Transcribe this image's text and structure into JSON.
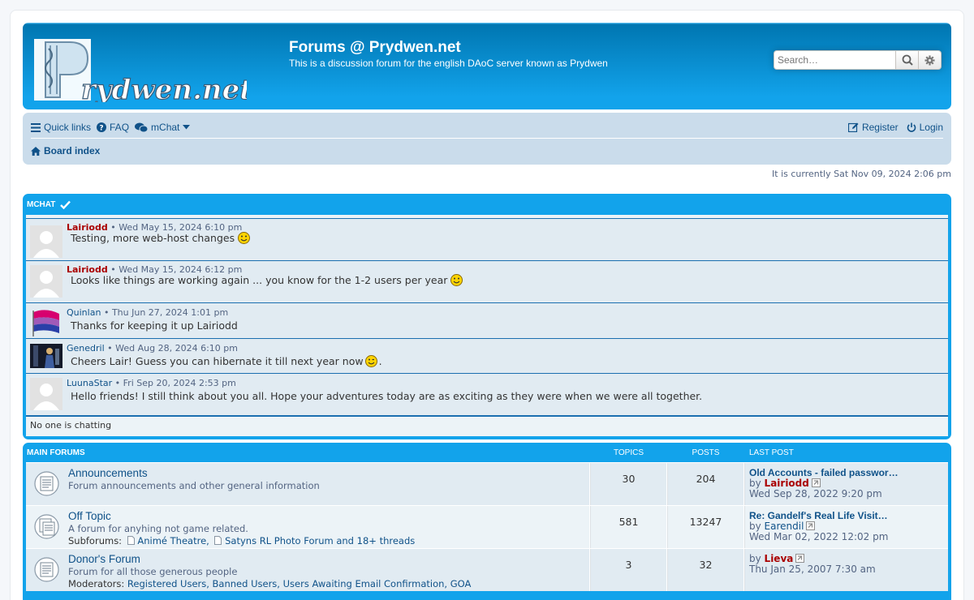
{
  "header": {
    "site_title": "Forums @ Prydwen.net",
    "site_description": "This is a discussion forum for the english DAoC server known as Prydwen",
    "logo_text": "Prydwen.net",
    "search_placeholder": "Search…"
  },
  "nav": {
    "quick_links": "Quick links",
    "faq": "FAQ",
    "mchat": "mChat",
    "register": "Register",
    "login": "Login",
    "board_index": "Board index"
  },
  "current_time": "It is currently Sat Nov 09, 2024 2:06 pm",
  "mchat": {
    "title": "MCHAT",
    "messages": [
      {
        "user": "Lairiodd",
        "time": "Wed May 15, 2024 6:10 pm",
        "text": "Testing, more web-host changes",
        "smiley": true,
        "user_color": "#aa0000"
      },
      {
        "user": "Lairiodd",
        "time": "Wed May 15, 2024 6:12 pm",
        "text": "Looks like things are working again ... you know for the 1-2 users per year",
        "smiley": true,
        "user_color": "#aa0000"
      },
      {
        "user": "Quinlan",
        "time": "Thu Jun 27, 2024 1:01 pm",
        "text": "Thanks for keeping it up Lairiodd",
        "smiley": false
      },
      {
        "user": "Genedril",
        "time": "Wed Aug 28, 2024 6:10 pm",
        "text": "Cheers Lair! Guess you can hibernate it till next year now",
        "smiley": true,
        "suffix": "."
      },
      {
        "user": "LuunaStar",
        "time": "Fri Sep 20, 2024 2:53 pm",
        "text": "Hello friends! I still think about you all. Hope your adventures today are as exciting as they were when we were all together.",
        "smiley": false
      }
    ],
    "status": "No one is chatting",
    "separator": "•"
  },
  "forums": {
    "title": "MAIN FORUMS",
    "col_topics": "TOPICS",
    "col_posts": "POSTS",
    "col_last": "LAST POST",
    "by": "by",
    "subforums_label": "Subforums:",
    "moderators_label": "Moderators:",
    "rows": [
      {
        "name": "Announcements",
        "desc": "Forum announcements and other general information",
        "topics": "30",
        "posts": "204",
        "last_title": "Old Accounts - failed passwor…",
        "last_user": "Lairiodd",
        "last_time": "Wed Sep 28, 2022 9:20 pm"
      },
      {
        "name": "Off Topic",
        "desc": "A forum for anyhing not game related.",
        "topics": "581",
        "posts": "13247",
        "subforum_1": "Animé Theatre,",
        "subforum_2": "Satyns RL Photo Forum and 18+ threads",
        "last_title": "Re: Gandelf's Real Life Visit…",
        "last_user": "Earendil",
        "last_time": "Wed Mar 02, 2022 12:02 pm"
      },
      {
        "name": "Donor's Forum",
        "desc": "Forum for all those generous people",
        "topics": "3",
        "posts": "32",
        "moderators": "Registered Users, Banned Users, Users Awaiting Email Confirmation, GOA",
        "last_user": "Lieva",
        "last_time": "Thu Jan 25, 2007 7:30 am"
      }
    ]
  }
}
